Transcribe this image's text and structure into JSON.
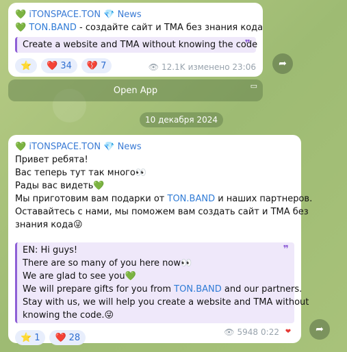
{
  "msg1": {
    "title": {
      "heart": "💚",
      "channel": "iTONSPACE.TON",
      "diamond": "💎",
      "news": "News"
    },
    "line2": {
      "heart": "💚",
      "link": "TON.BAND",
      "text": " - создайте сайт и ТМА без знания кода"
    },
    "quote": "Create a website and TMA without knowing the code",
    "reactions": [
      {
        "emoji": "⭐",
        "count": ""
      },
      {
        "emoji": "❤️",
        "count": "34"
      },
      {
        "emoji": "💔",
        "count": "7"
      }
    ],
    "views": "12.1K",
    "edited": "изменено 23:06"
  },
  "open_app": "Open App",
  "date": "10 декабря 2024",
  "msg2": {
    "title": {
      "heart": "💚",
      "channel": "iTONSPACE.TON",
      "diamond": "💎",
      "news": "News"
    },
    "ru": {
      "l1": "Привет ребята!",
      "l2": "Вас теперь тут так много👀",
      "l3": "Рады вас видеть💚",
      "l4a": "Мы приготовим вам подарки от ",
      "l4link": "TON.BAND",
      "l4b": " и наших партнеров.",
      "l5": "Оставайтесь с нами, мы поможем вам создать сайт и ТМА без",
      "l6": "знания кода😜"
    },
    "en": {
      "l1": "EN: Hi guys!",
      "l2": "There are so many of you here now👀",
      "l3": "We are glad to see you💚",
      "l4a": "We will prepare gifts for you from ",
      "l4link": "TON.BAND",
      "l4b": " and our partners.",
      "l5": "Stay with us, we will help you create a website and TMA without",
      "l6": "knowing the code.😜"
    },
    "reactions": [
      {
        "emoji": "⭐",
        "count": "1"
      },
      {
        "emoji": "❤️",
        "count": "28"
      }
    ],
    "views": "5948",
    "time": "0:22",
    "own_reaction": "❤"
  },
  "icons": {
    "share": "➦",
    "eye": "👁",
    "open_app_icon": "▭"
  }
}
